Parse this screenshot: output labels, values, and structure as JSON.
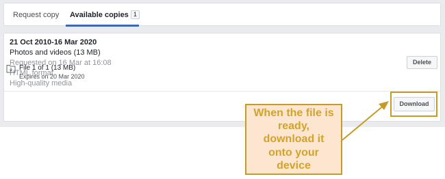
{
  "tabs": {
    "request_copy": "Request copy",
    "available_copies": "Available copies",
    "available_count": "1"
  },
  "copy": {
    "date_range": "21 Oct 2010-16 Mar 2020",
    "summary": "Photos and videos (13 MB)",
    "requested": "Requested on 16 Mar at 16:08",
    "format": "HTML format",
    "quality": "High-quality media",
    "delete_label": "Delete"
  },
  "file": {
    "icon": "download-file-icon",
    "title": "File 1 of 1 (13 MB)",
    "expiry": "Expires on 20 Mar 2020",
    "download_label": "Download"
  },
  "annotation": {
    "text": "When the file is\nready,\ndownload it\nonto your\ndevice",
    "color": "#d2a32b",
    "border_color": "#c79a25",
    "fill_color": "#fde6d0"
  },
  "colors": {
    "accent": "#4267b2",
    "background": "#e9ebee"
  }
}
